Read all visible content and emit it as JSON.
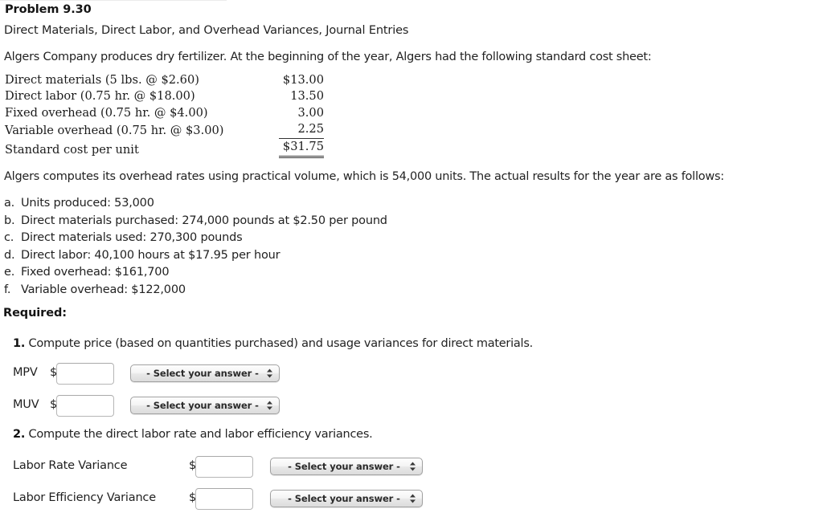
{
  "problem": {
    "title": "Problem 9.30",
    "subtitle": "Direct Materials, Direct Labor, and Overhead Variances, Journal Entries",
    "intro": "Algers Company produces dry fertilizer. At the beginning of the year, Algers had the following standard cost sheet:",
    "practical_volume_note": "Algers computes its overhead rates using practical volume, which is 54,000 units. The actual results for the year are as follows:"
  },
  "cost_sheet": {
    "rows": [
      {
        "label": "Direct materials (5 lbs. @ $2.60)",
        "amount": "$13.00",
        "rule": "none",
        "indent": false
      },
      {
        "label": "Direct labor (0.75 hr. @ $18.00)",
        "amount": "13.50",
        "rule": "none",
        "indent": false
      },
      {
        "label": "Fixed overhead (0.75 hr. @ $4.00)",
        "amount": "3.00",
        "rule": "none",
        "indent": false
      },
      {
        "label": "Variable overhead (0.75 hr. @ $3.00)",
        "amount": "2.25",
        "rule": "single",
        "indent": false
      },
      {
        "label": "Standard cost per unit",
        "amount": "$31.75",
        "rule": "double",
        "indent": true
      }
    ]
  },
  "facts": [
    {
      "mark": "a.",
      "text": "Units produced: 53,000"
    },
    {
      "mark": "b.",
      "text": "Direct materials purchased: 274,000 pounds at $2.50 per pound"
    },
    {
      "mark": "c.",
      "text": "Direct materials used: 270,300 pounds"
    },
    {
      "mark": "d.",
      "text": "Direct labor: 40,100 hours at $17.95 per hour"
    },
    {
      "mark": "e.",
      "text": "Fixed overhead: $161,700"
    },
    {
      "mark": "f.",
      "text": "Variable overhead: $122,000"
    }
  ],
  "required_label": "Required:",
  "questions": {
    "q1": {
      "number": "1.",
      "text": "Compute price (based on quantities purchased) and usage variances for direct materials."
    },
    "q2": {
      "number": "2.",
      "text": "Compute the direct labor rate and labor efficiency variances."
    }
  },
  "form": {
    "select_placeholder": "- Select your answer -",
    "dollar_sign": "$",
    "rows": [
      {
        "label": "MPV",
        "value": "",
        "select": "- Select your answer -"
      },
      {
        "label": "MUV",
        "value": "",
        "select": "- Select your answer -"
      },
      {
        "label": "Labor Rate Variance",
        "value": "",
        "select": "- Select your answer -"
      },
      {
        "label": "Labor Efficiency Variance",
        "value": "",
        "select": "- Select your answer -"
      }
    ]
  },
  "colors": {
    "page_background": "#ffffff",
    "text": "#222222",
    "control_border": "#a0a0a0",
    "divider": "#ebebeb"
  }
}
